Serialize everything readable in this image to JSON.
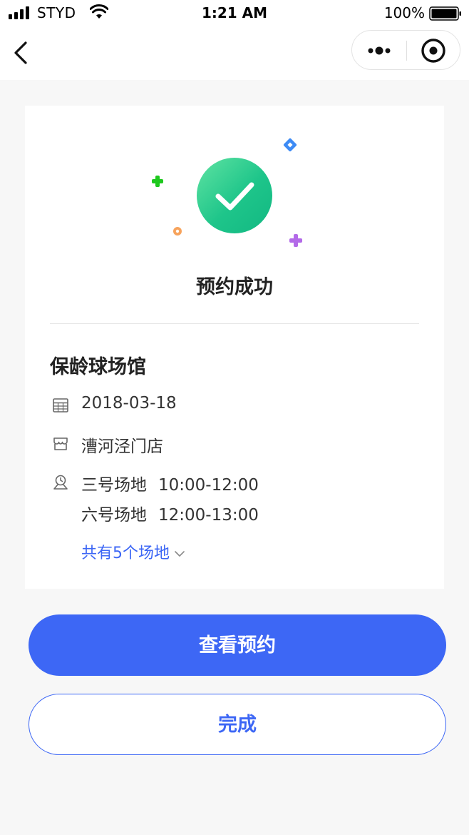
{
  "status_bar": {
    "carrier": "STYD",
    "time": "1:21 AM",
    "battery": "100%",
    "icons": [
      "signal-icon",
      "wifi-icon",
      "battery-icon"
    ]
  },
  "nav": {
    "icons": [
      "back-icon",
      "more-icon",
      "close-mini-program-icon"
    ]
  },
  "result": {
    "title": "预约成功",
    "icon": "checkmark-icon",
    "colors": {
      "success_green": "#1ec58a"
    }
  },
  "booking": {
    "venue": "保龄球场馆",
    "date": "2018-03-18",
    "store": "漕河泾门店",
    "courts": [
      {
        "name": "三号场地",
        "time": "10:00-12:00"
      },
      {
        "name": "六号场地",
        "time": "12:00-13:00"
      }
    ],
    "more_label": "共有5个场地",
    "icons": [
      "calendar-icon",
      "store-icon",
      "location-clock-icon",
      "chevron-down-icon"
    ]
  },
  "actions": {
    "view_label": "查看预约",
    "done_label": "完成",
    "accent_color": "#3d67f5"
  }
}
